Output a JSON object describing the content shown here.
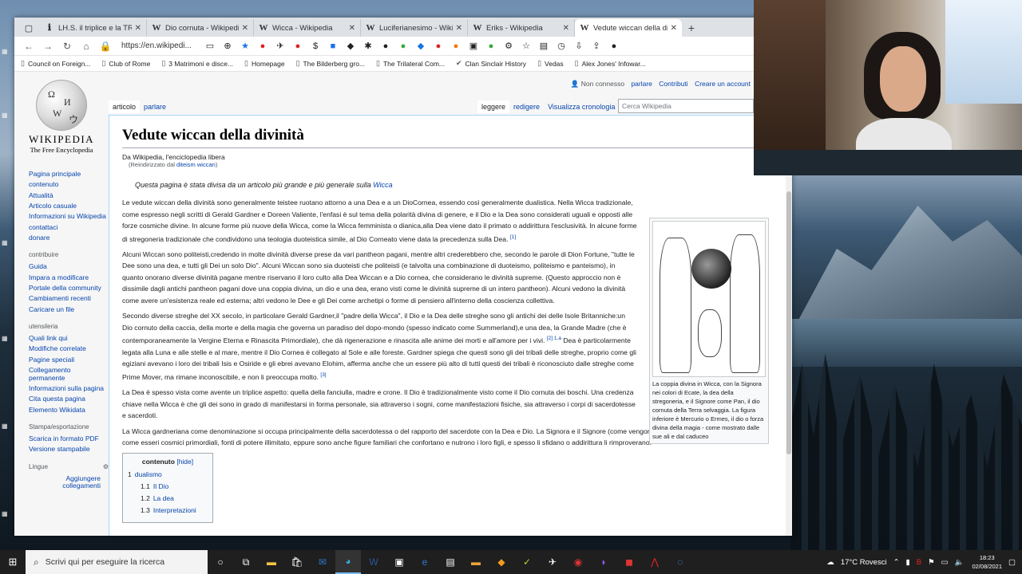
{
  "browser": {
    "tabs": [
      {
        "favicon": "ℹ",
        "label": "LH.S. il triplice e la TRIAD"
      },
      {
        "favicon": "W",
        "label": "Dio cornuta - Wikipedia"
      },
      {
        "favicon": "W",
        "label": "Wicca - Wikipedia"
      },
      {
        "favicon": "W",
        "label": "Luciferianesimo - Wikipe"
      },
      {
        "favicon": "W",
        "label": "Eriks - Wikipedia"
      },
      {
        "favicon": "W",
        "label": "Vedute wiccan della divi"
      }
    ],
    "address": "https://en.wikipedi...",
    "bookmarks": [
      "Council on Foreign...",
      "Club of Rome",
      "3 Matrimoni e disce...",
      "Homepage",
      "The Bilderberg gro...",
      "The Trilateral Com...",
      "Clan Sinclair History",
      "Vedas",
      "Alex Jones' Infowar..."
    ]
  },
  "wiki": {
    "user_status": "Non connesso",
    "user_links": [
      "parlare",
      "Contributi",
      "Creare un account"
    ],
    "logo_word": "WIKIPEDIA",
    "logo_tag": "The Free Encyclopedia",
    "tabs_left": [
      "articolo",
      "parlare"
    ],
    "tabs_right": [
      "leggere",
      "redigere",
      "Visualizza cronologia"
    ],
    "search_placeholder": "Cerca Wikipedia",
    "sidebar": {
      "main": [
        "Pagina principale",
        "contenuto",
        "Attualità",
        "Articolo casuale",
        "Informazioni su Wikipedia",
        "contattaci",
        "donare"
      ],
      "contribute_heading": "contribuire",
      "contribute": [
        "Guida",
        "Impara a modificare",
        "Portale della community",
        "Cambiamenti recenti",
        "Caricare un file"
      ],
      "tools_heading": "utensileria",
      "tools": [
        "Quali link qui",
        "Modifiche correlate",
        "Pagine speciali",
        "Collegamento permanente",
        "Informazioni sulla pagina",
        "Cita questa pagina",
        "Elemento Wikidata"
      ],
      "print_heading": "Stampa/esportazione",
      "print": [
        "Scarica in formato PDF",
        "Versione stampabile"
      ],
      "lang_heading": "Lingue",
      "lang_link": "Aggiungere collegamenti"
    },
    "title": "Vedute wiccan della divinità",
    "site_sub": "Da Wikipedia, l'enciclopedia libera",
    "redirect_prefix": "(Reindirizzato dal",
    "redirect_link": "diteism wiccan",
    "redirect_suffix": ")",
    "hatnote_text": "Questa pagina è stata divisa da un articolo più grande e più generale sulla",
    "hatnote_link": "Wicca",
    "p1": "Le vedute wiccan della divinità sono generalmente teistee ruotano attorno a una Dea e a un DioCornea, essendo così generalmente dualistica. Nella Wicca tradizionale, come espresso negli scritti di Gerald Gardner e Doreen Valiente, l'enfasi è sul tema della polarità divina di genere, e il Dio e la Dea sono considerati uguali e opposti alle forze cosmiche divine. In alcune forme più nuove della Wicca, come la Wicca femminista o dianica,alla Dea viene dato il primato o addirittura l'esclusività. In alcune forme di stregoneria tradizionale che condividono una teologia duoteistica simile, al Dio Corneato viene data la precedenza sulla Dea.",
    "p1_ref": "[1]",
    "p2": "Alcuni Wiccan sono politeisti,credendo in molte divinità diverse prese da vari pantheon pagani, mentre altri crederebbero che, secondo le parole di Dion Fortune, \"tutte le Dee sono una dea, e tutti gli Dei un solo Dio\". Alcuni Wiccan sono sia duoteisti che politeisti (e talvolta una combinazione di duoteismo, politeismo e panteismo), in quanto onorano diverse divinità pagane mentre riservano il loro culto alla Dea Wiccan e a Dio cornea, che considerano le divinità supreme. (Questo approccio non è dissimile dagli antichi pantheon pagani dove una coppia divina, un dio e una dea, erano visti come le divinità supreme di un intero pantheon). Alcuni vedono la divinità come avere un'esistenza reale ed esterna; altri vedono le Dee e gli Dei come archetipi o forme di pensiero all'interno della coscienza collettiva.",
    "p3": "Secondo diverse streghe del XX secolo, in particolare Gerald Gardner,il \"padre della Wicca\", il Dio e la Dea delle streghe sono gli antichi dei delle Isole Britanniche:un Dio cornuto della caccia, della morte e della magia che governa un paradiso del dopo-mondo (spesso indicato come Summerland),e una dea, la Grande Madre (che è contemporaneamente la Vergine Eterna e Rinascita Primordiale), che dà rigenerazione e rinascita alle anime dei morti e all'amore per i vivi.",
    "p3_ref": "[2] 1.a",
    "p3b": "Dea è particolarmente legata alla Luna e alle stelle e al mare, mentre il Dio Cornea è collegato al Sole e alle foreste. Gardner spiega che questi sono gli dei tribali delle streghe, proprio come gli egiziani avevano i loro dei tribali Isis e Osiride e gli ebrei avevano Elohim, afferma anche che un essere più alto di tutti questi dei tribali è riconosciuto dalle streghe come Prime Mover, ma rimane inconoscibile, e non li preoccupa molto.",
    "p3b_ref": "[3]",
    "p4": "La Dea è spesso vista come avente un triplice aspetto: quella della fanciulla, madre e crone. Il Dio è tradizionalmente visto come il Dio cornuta dei boschi. Una credenza chiave nella Wicca è che gli dei sono in grado di manifestarsi in forma personale, sia attraverso i sogni, come manifestazioni fisiche, sia attraverso i corpi di sacerdotesse e sacerdoti.",
    "p5": "La Wicca gardneriana come denominazione si occupa principalmente della sacerdotessa o del rapporto del sacerdote con la Dea e Dio. La Signora e il Signore (come vengono spesso chiamati) sono visti come esseri cosmici primordiali, fonti di potere illimitato, eppure sono anche figure familiari che confortano e nutrono i loro figli, e spesso li sfidano o addirittura li rimproverano.",
    "caption": "La coppia divina in Wicca, con la Signora nei colori di Ecate, la dea della stregoneria, e il Signore come Pan, il dio cornuta della Terra selvaggia. La figura inferiore è Mercurio o Ermes, il dio o forza divina della magia - come mostrato dalle sue ali e dal caduceo",
    "toc": {
      "title": "contenuto",
      "hide": "[hide]",
      "items": [
        {
          "num": "1",
          "label": "dualismo",
          "sub": false
        },
        {
          "num": "1.1",
          "label": "Il Dio",
          "sub": true
        },
        {
          "num": "1.2",
          "label": "La dea",
          "sub": true
        },
        {
          "num": "1.3",
          "label": "Interpretazioni",
          "sub": true
        }
      ]
    }
  },
  "taskbar": {
    "search_placeholder": "Scrivi qui per eseguire la ricerca",
    "weather": "17°C Rovesci",
    "time": "18:23",
    "date": "02/08/2021"
  },
  "colors": {
    "link": "#0645ad",
    "taskbar": "#1f1f1f",
    "tab_bar": "#dee1e6"
  }
}
